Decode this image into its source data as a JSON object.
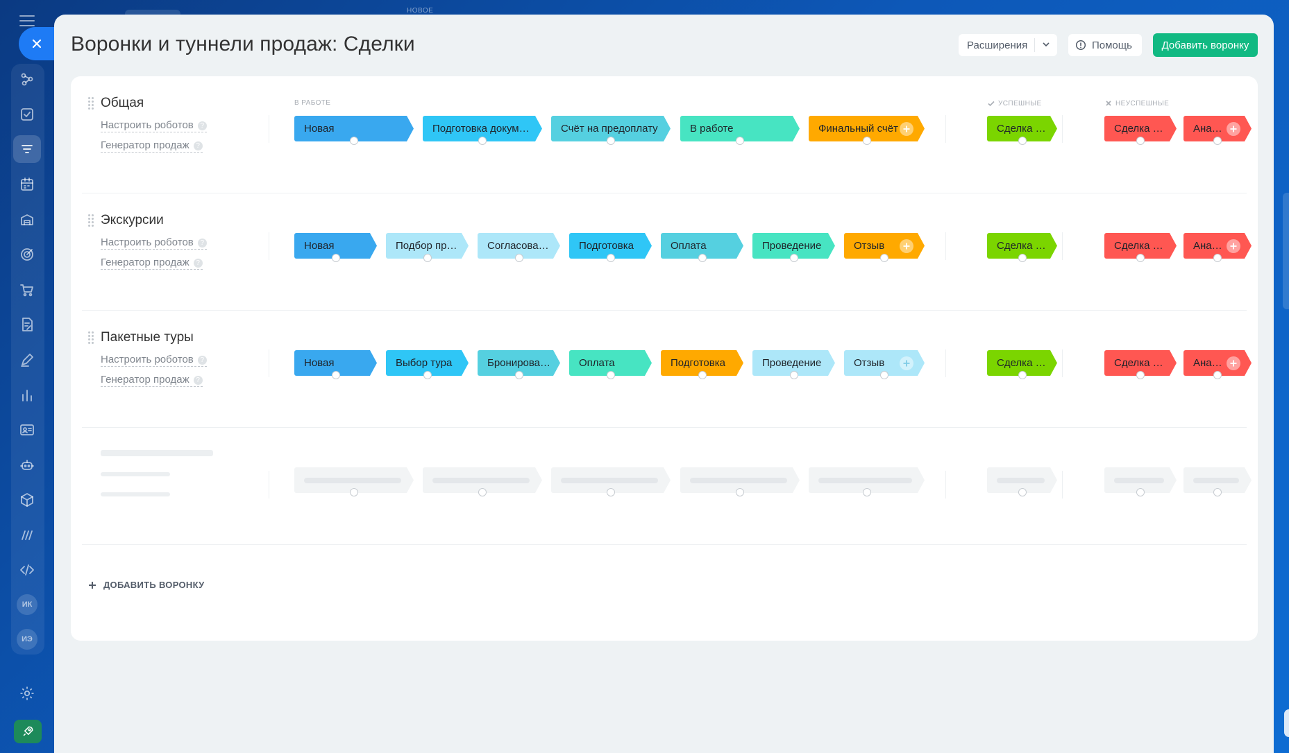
{
  "app": {
    "bg_tab_label": "НОВОЕ"
  },
  "leftbar": {
    "items": [
      {
        "icon": "funnel-network-icon"
      },
      {
        "icon": "checkbox-task-icon"
      },
      {
        "icon": "crm-filter-icon",
        "active": true
      },
      {
        "icon": "calendar-grid-icon"
      },
      {
        "icon": "warehouse-icon"
      },
      {
        "icon": "target-icon"
      },
      {
        "icon": "cart-icon"
      },
      {
        "icon": "document-sign-icon"
      },
      {
        "icon": "pen-icon"
      },
      {
        "icon": "bar-chart-icon"
      },
      {
        "icon": "contact-card-icon"
      },
      {
        "icon": "robot-icon"
      },
      {
        "icon": "cube-icon"
      },
      {
        "icon": "market-icon"
      },
      {
        "icon": "code-icon"
      }
    ],
    "avatars": [
      "ИК",
      "ИЭ"
    ]
  },
  "header": {
    "title": "Воронки и туннели продаж: Сделки",
    "extensions_label": "Расширения",
    "help_label": "Помощь",
    "add_funnel_label": "Добавить воронку"
  },
  "groups": {
    "in_progress": "В РАБОТЕ",
    "success": "УСПЕШНЫЕ",
    "fail": "НЕУСПЕШНЫЕ"
  },
  "funnel_links": {
    "robots": "Настроить роботов",
    "generator": "Генератор продаж",
    "help_mark": "?"
  },
  "colors": {
    "blue": "#39a8ef",
    "sky": "#2fc6f6",
    "teal": "#55d0e0",
    "mint": "#47e4c2",
    "orange": "#ffa900",
    "lightsky": "#ade7f9",
    "green": "#7bd500",
    "red": "#ff5752",
    "accent": "#11b982"
  },
  "funnels": [
    {
      "name": "Общая",
      "stages": [
        {
          "label": "Новая",
          "color": "#39a8ef"
        },
        {
          "label": "Подготовка документов",
          "color": "#2fc6f6"
        },
        {
          "label": "Счёт на предоплату",
          "color": "#55d0e0"
        },
        {
          "label": "В работе",
          "color": "#47e4c2"
        },
        {
          "label": "Финальный счёт",
          "color": "#ffa900"
        }
      ],
      "success": {
        "label": "Сделка успешна",
        "color": "#7bd500"
      },
      "fail": [
        {
          "label": "Сделка провалена",
          "color": "#ff5752"
        },
        {
          "label": "Анализ причины провала",
          "color": "#ff5752"
        }
      ]
    },
    {
      "name": "Экскурсии",
      "stages": [
        {
          "label": "Новая",
          "color": "#39a8ef"
        },
        {
          "label": "Подбор программы",
          "color": "#ade7f9"
        },
        {
          "label": "Согласование",
          "color": "#ade7f9"
        },
        {
          "label": "Подготовка",
          "color": "#2fc6f6"
        },
        {
          "label": "Оплата",
          "color": "#55d0e0"
        },
        {
          "label": "Проведение",
          "color": "#47e4c2"
        },
        {
          "label": "Отзыв",
          "color": "#ffa900"
        }
      ],
      "success": {
        "label": "Сделка успешна",
        "color": "#7bd500"
      },
      "fail": [
        {
          "label": "Сделка провалена",
          "color": "#ff5752"
        },
        {
          "label": "Анализ причины провала",
          "color": "#ff5752"
        }
      ]
    },
    {
      "name": "Пакетные туры",
      "stages": [
        {
          "label": "Новая",
          "color": "#39a8ef"
        },
        {
          "label": "Выбор тура",
          "color": "#2fc6f6"
        },
        {
          "label": "Бронирование",
          "color": "#55d0e0"
        },
        {
          "label": "Оплата",
          "color": "#47e4c2"
        },
        {
          "label": "Подготовка",
          "color": "#ffa900"
        },
        {
          "label": "Проведение",
          "color": "#ade7f9"
        },
        {
          "label": "Отзыв",
          "color": "#ade7f9"
        }
      ],
      "success": {
        "label": "Сделка успешна",
        "color": "#7bd500"
      },
      "fail": [
        {
          "label": "Сделка провалена",
          "color": "#ff5752"
        },
        {
          "label": "Анализ причины провала",
          "color": "#ff5752"
        }
      ]
    }
  ],
  "footer": {
    "add_funnel_link": "ДОБАВИТЬ ВОРОНКУ"
  }
}
